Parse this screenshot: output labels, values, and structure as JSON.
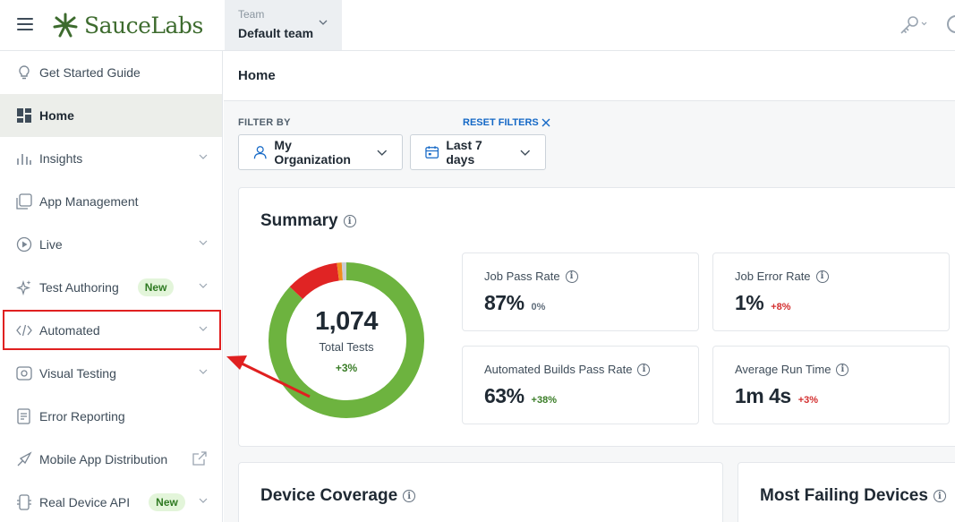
{
  "brand": {
    "name": "SauceLabs",
    "logo_color": "#3d6b2e"
  },
  "team": {
    "label": "Team",
    "value": "Default team"
  },
  "sidebar": {
    "items": [
      {
        "label": "Get Started Guide",
        "icon": "lightbulb-icon"
      },
      {
        "label": "Home",
        "icon": "dashboard-icon",
        "active": true
      },
      {
        "label": "Insights",
        "icon": "bar-chart-icon",
        "chevron": true
      },
      {
        "label": "App Management",
        "icon": "app-management-icon"
      },
      {
        "label": "Live",
        "icon": "play-icon",
        "chevron": true
      },
      {
        "label": "Test Authoring",
        "icon": "sparkle-icon",
        "chevron": true,
        "badge": "New"
      },
      {
        "label": "Automated",
        "icon": "code-icon",
        "chevron": true,
        "highlighted": true
      },
      {
        "label": "Visual Testing",
        "icon": "eye-icon",
        "chevron": true
      },
      {
        "label": "Error Reporting",
        "icon": "error-report-icon"
      },
      {
        "label": "Mobile App Distribution",
        "icon": "mobile-distribution-icon",
        "external": true
      },
      {
        "label": "Real Device API",
        "icon": "api-icon",
        "chevron": true,
        "badge": "New"
      }
    ]
  },
  "page": {
    "title": "Home"
  },
  "filters": {
    "label": "FILTER BY",
    "reset": "RESET FILTERS",
    "organization": "My Organization",
    "date_range": "Last 7 days"
  },
  "summary": {
    "title": "Summary",
    "total_tests": "1,074",
    "total_label": "Total Tests",
    "total_delta": "+3%",
    "donut": {
      "passed": 0.87,
      "failed": 0.11,
      "error": 0.01,
      "other": 0.01,
      "colors": {
        "passed": "#6db33f",
        "failed": "#e02424",
        "error": "#f08c1e",
        "other": "#c9ccd1"
      }
    },
    "metrics": [
      {
        "label": "Job Pass Rate",
        "value": "87%",
        "delta": "0%",
        "delta_tone": "neutral"
      },
      {
        "label": "Job Error Rate",
        "value": "1%",
        "delta": "+8%",
        "delta_tone": "red"
      },
      {
        "label": "Automated Builds Pass Rate",
        "value": "63%",
        "delta": "+38%",
        "delta_tone": "green"
      },
      {
        "label": "Average Run Time",
        "value": "1m 4s",
        "delta": "+3%",
        "delta_tone": "red"
      }
    ]
  },
  "device_coverage": {
    "title": "Device Coverage"
  },
  "most_failing": {
    "title": "Most Failing Devices"
  },
  "colors": {
    "highlight": "#e02020",
    "link": "#1468c6"
  }
}
